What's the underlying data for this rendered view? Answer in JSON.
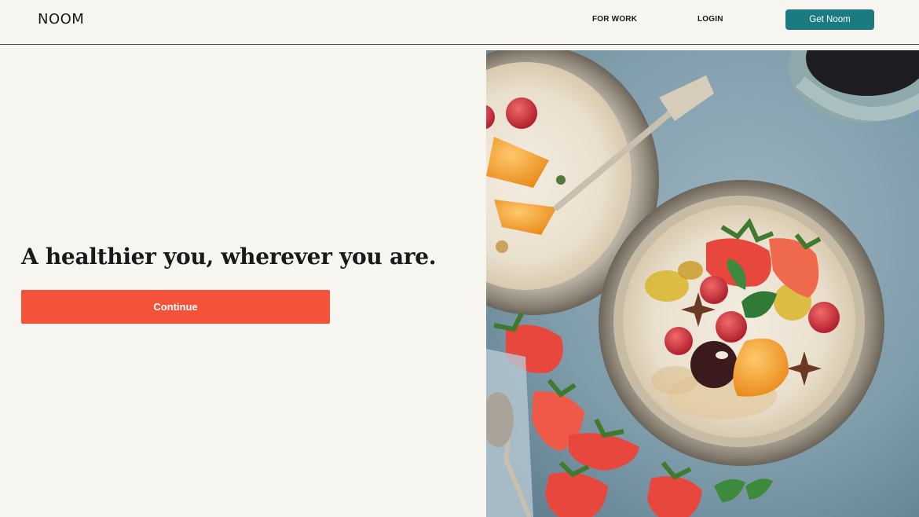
{
  "header": {
    "logo": "NOOM",
    "nav": {
      "for_work": "FOR WORK",
      "login": "LOGIN"
    },
    "cta_label": "Get Noom"
  },
  "hero": {
    "headline": "A healthier you, wherever you are.",
    "continue_label": "Continue",
    "image_icon": "food-photo-oatmeal-bowls"
  },
  "colors": {
    "background": "#f7f5ef",
    "cta_teal": "#1b7b80",
    "continue_coral": "#f4533a",
    "text": "#1a1a1a"
  }
}
